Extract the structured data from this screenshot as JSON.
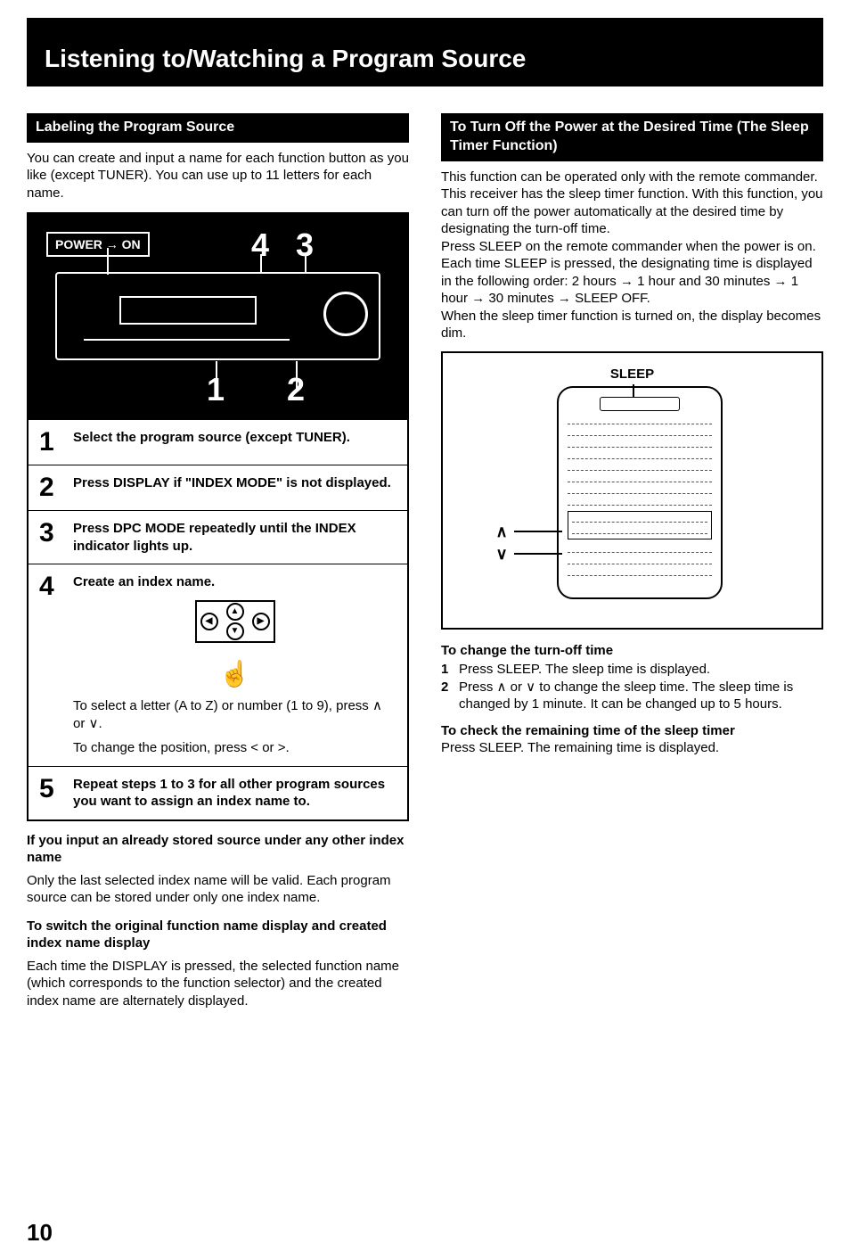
{
  "title": "Listening to/Watching a Program Source",
  "page_number": "10",
  "left": {
    "subhead": "Labeling the Program Source",
    "intro": "You can create and input a name for each function button as you like (except TUNER). You can use up to 11 letters for each name.",
    "power_label": "POWER → ON",
    "callout_4": "4",
    "callout_3": "3",
    "callout_1": "1",
    "callout_2": "2",
    "steps": [
      {
        "n": "1",
        "text": "Select the program source (except TUNER)."
      },
      {
        "n": "2",
        "text": "Press DISPLAY if \"INDEX MODE\" is not displayed."
      },
      {
        "n": "3",
        "text": "Press DPC MODE repeatedly until the INDEX indicator lights up."
      },
      {
        "n": "4",
        "text": "Create an index name.",
        "sub1": "To select a letter (A to Z) or number (1 to 9), press ∧ or ∨.",
        "sub2": "To change the position, press < or >."
      },
      {
        "n": "5",
        "text": "Repeat steps 1 to 3 for all other program sources you want to assign an index name to."
      }
    ],
    "note1_head": "If you input an already stored source under any other index name",
    "note1_body": "Only the last selected index name will be valid. Each program source can be stored under only one index name.",
    "note2_head": "To switch the original function name display and created index name display",
    "note2_body": "Each time the DISPLAY is pressed, the selected function name (which corresponds to the function selector) and the created index name are alternately displayed."
  },
  "right": {
    "subhead": "To Turn Off the Power at the Desired Time (The Sleep Timer Function)",
    "p1": "This function can be operated only with the remote commander.",
    "p2": "This receiver has the sleep timer function. With this function, you can turn off the power automatically at the desired time by designating the turn-off time.",
    "p3": "Press SLEEP on the remote commander when the power is on. Each time SLEEP is pressed, the designating time is displayed in the following order: 2 hours → 1 hour and 30 minutes → 1 hour → 30 minutes → SLEEP OFF.",
    "p4": "When the sleep timer function is turned on, the display becomes dim.",
    "sleep_label": "SLEEP",
    "up_sym": "∧",
    "dn_sym": "∨",
    "change_head": "To change the turn-off time",
    "change_steps": [
      {
        "n": "1",
        "text": "Press SLEEP. The sleep time is displayed."
      },
      {
        "n": "2",
        "text": "Press ∧ or ∨ to change the sleep time. The sleep time is changed by 1 minute. It can be changed up to 5 hours."
      }
    ],
    "check_head": "To check the remaining time of the sleep timer",
    "check_body": "Press SLEEP. The remaining time is displayed."
  }
}
